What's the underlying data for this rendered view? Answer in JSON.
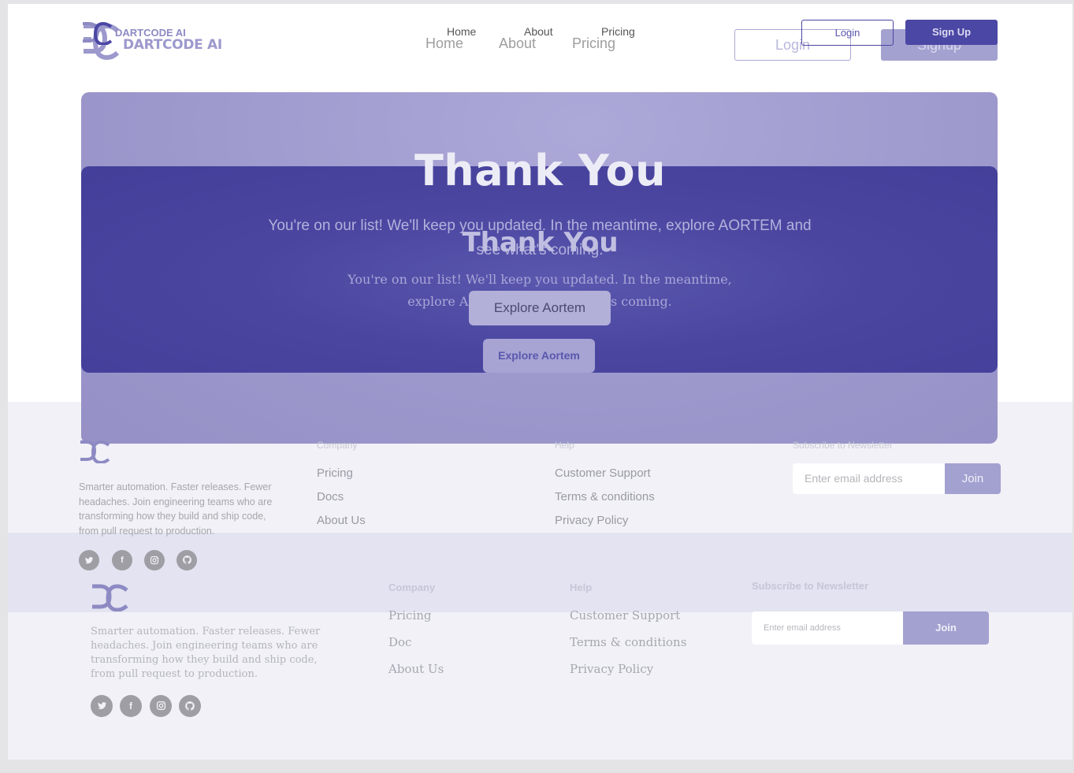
{
  "nav_faded": {
    "brand": "DARTCODE AI",
    "links": [
      "Home",
      "About",
      "Pricing"
    ],
    "login_label": "Login",
    "signup_label": "Signup"
  },
  "nav": {
    "brand": "DARTCODE AI",
    "links": [
      "Home",
      "About",
      "Pricing"
    ],
    "login_label": "Login",
    "signup_label": "Sign Up"
  },
  "hero_faded": {
    "title": "Thank You",
    "subtitle": "You're on our list! We'll keep you updated. In the meantime, explore AORTEM and see what's coming.",
    "button_label": "Explore Aortem"
  },
  "hero": {
    "title": "Thank You",
    "subtitle": "You're on our list! We'll keep you updated. In the meantime, explore AORTEM and see what's coming.",
    "button_label": "Explore Aortem"
  },
  "footer_faded": {
    "description": "Smarter automation. Faster releases. Fewer headaches. Join engineering teams who are transforming how they build and ship code, from pull request to production.",
    "company_heading": "Company",
    "company_links": [
      "Pricing",
      "Docs",
      "About Us"
    ],
    "help_heading": "Help",
    "help_links": [
      "Customer Support",
      "Terms & conditions",
      "Privacy Policy"
    ],
    "newsletter_heading": "Subscribe to Newsletter",
    "email_placeholder": "Enter email address",
    "join_label": "Join",
    "social_icons": [
      "twitter-icon",
      "facebook-icon",
      "instagram-icon",
      "github-icon"
    ]
  },
  "footer": {
    "description": "Smarter automation. Faster releases. Fewer headaches. Join engineering teams who are transforming how they build and ship code, from pull request to production.",
    "company_heading": "Company",
    "company_links": [
      "Pricing",
      "Doc",
      "About Us"
    ],
    "help_heading": "Help",
    "help_links": [
      "Customer Support",
      "Terms & conditions",
      "Privacy Policy"
    ],
    "newsletter_heading": "Subscribe to Newsletter",
    "email_placeholder": "Enter email address",
    "join_label": "Join",
    "social_icons": [
      "twitter-icon",
      "facebook-icon",
      "instagram-icon",
      "github-icon"
    ]
  },
  "colors": {
    "accent": "#4b47a4",
    "accent_light": "#a3a1d0",
    "hero_dark": "#403c98",
    "hero_light": "#9c98cc"
  }
}
